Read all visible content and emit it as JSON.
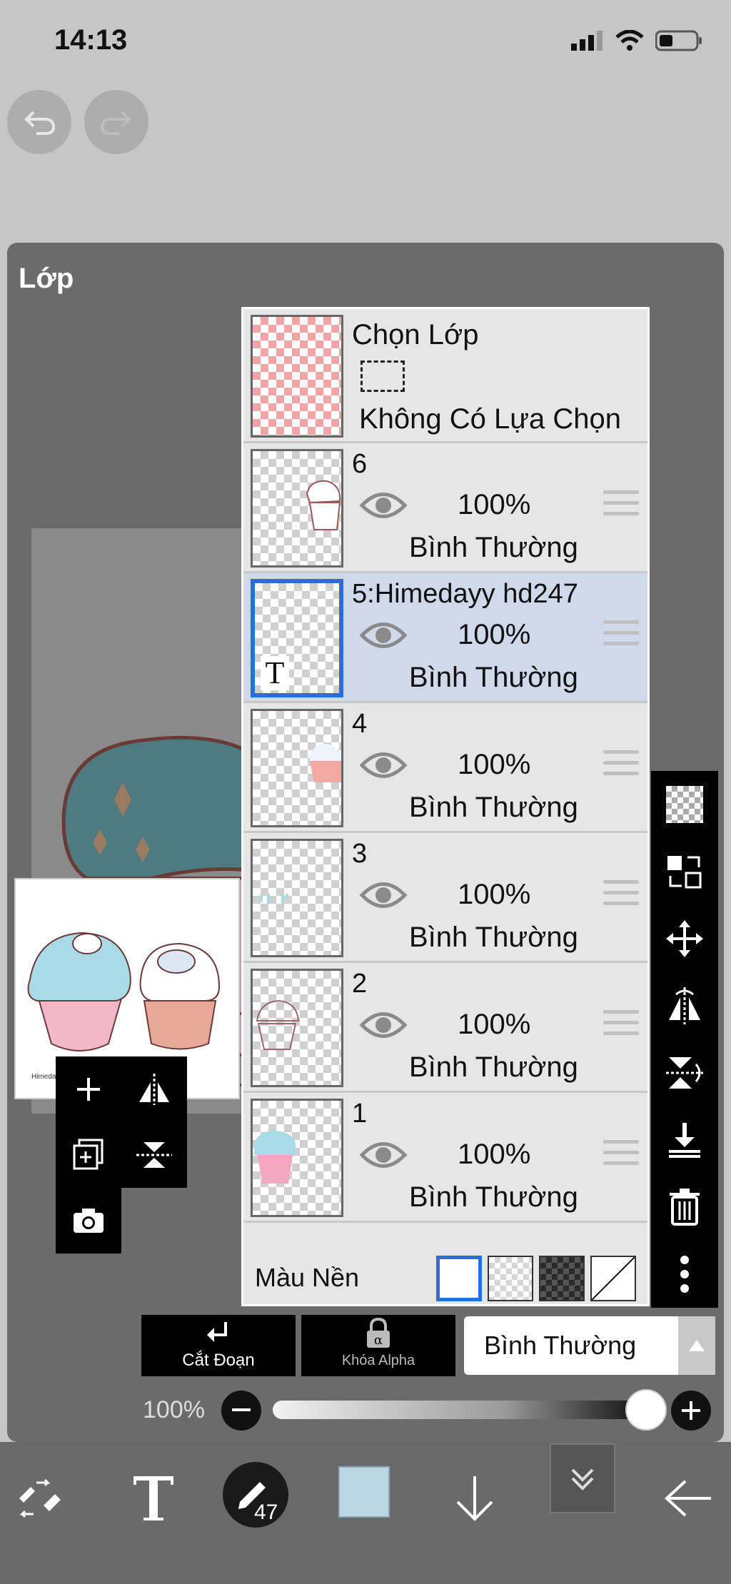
{
  "status": {
    "time": "14:13"
  },
  "panel": {
    "title": "Lớp"
  },
  "preview": {
    "caption": "Himedayy hd247"
  },
  "selection": {
    "title": "Chọn Lớp",
    "status": "Không Có Lựa Chọn"
  },
  "layers": [
    {
      "name": "6",
      "opacity": "100%",
      "blend": "Bình Thường",
      "selected": false,
      "type": "raster"
    },
    {
      "name": "5:Himedayy hd247",
      "opacity": "100%",
      "blend": "Bình Thường",
      "selected": true,
      "type": "text"
    },
    {
      "name": "4",
      "opacity": "100%",
      "blend": "Bình Thường",
      "selected": false,
      "type": "raster"
    },
    {
      "name": "3",
      "opacity": "100%",
      "blend": "Bình Thường",
      "selected": false,
      "type": "raster"
    },
    {
      "name": "2",
      "opacity": "100%",
      "blend": "Bình Thường",
      "selected": false,
      "type": "raster"
    },
    {
      "name": "1",
      "opacity": "100%",
      "blend": "Bình Thường",
      "selected": false,
      "type": "raster"
    }
  ],
  "text_layer_marker": "T",
  "background": {
    "label": "Màu Nền",
    "options": [
      "white",
      "checker-light",
      "checker-dark",
      "none"
    ],
    "selected": "white"
  },
  "actions": {
    "cut_label": "Cắt Đoạn",
    "alpha_lock_label": "Khóa Alpha"
  },
  "blend_mode": {
    "value": "Bình Thường"
  },
  "opacity": {
    "label": "100%",
    "value": 1.0
  },
  "toolbar": {
    "brush_size": "47",
    "color": "#bdd6e6"
  },
  "right_tools": [
    "checker-icon",
    "transfer-icon",
    "move-icon",
    "flip-horizontal-icon",
    "flip-vertical-icon",
    "merge-down-icon",
    "trash-icon",
    "more-icon"
  ]
}
